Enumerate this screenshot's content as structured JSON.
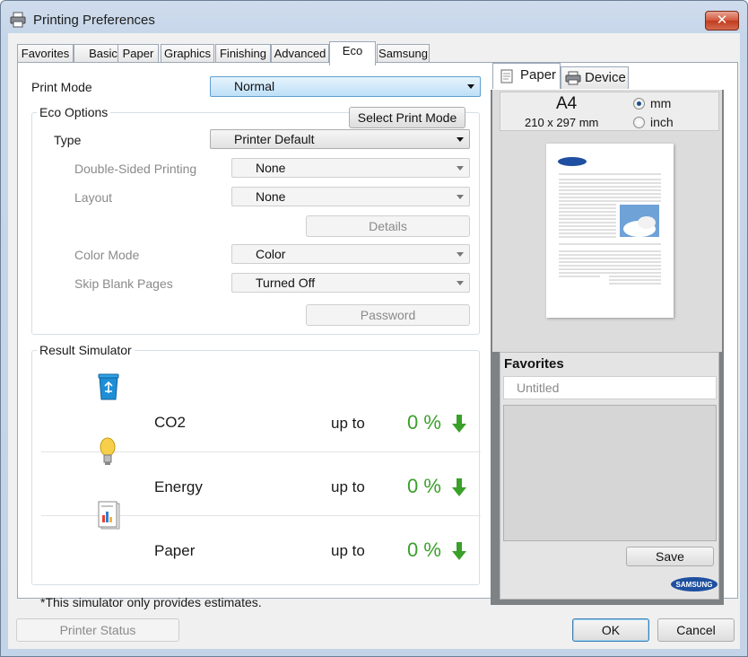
{
  "window": {
    "title": "Printing Preferences",
    "close_label": "✕"
  },
  "tabs": [
    {
      "label": "Favorites"
    },
    {
      "label": "Basic"
    },
    {
      "label": "Paper"
    },
    {
      "label": "Graphics"
    },
    {
      "label": "Finishing"
    },
    {
      "label": "Advanced"
    },
    {
      "label": "Eco"
    },
    {
      "label": "Samsung"
    }
  ],
  "active_tab": "Eco",
  "print_mode": {
    "label": "Print Mode",
    "value": "Normal"
  },
  "eco_options": {
    "title": "Eco Options",
    "select_print_mode_label": "Select Print Mode",
    "type_label": "Type",
    "type_value": "Printer Default",
    "double_sided_label": "Double-Sided Printing",
    "double_sided_value": "None",
    "layout_label": "Layout",
    "layout_value": "None",
    "details_label": "Details",
    "color_mode_label": "Color Mode",
    "color_mode_value": "Color",
    "skip_blank_label": "Skip Blank Pages",
    "skip_blank_value": "Turned Off",
    "password_label": "Password"
  },
  "result_simulator": {
    "title": "Result Simulator",
    "rows": [
      {
        "name": "CO2",
        "upto": "up to",
        "value": "0 %",
        "icon": "recycle-bin-icon"
      },
      {
        "name": "Energy",
        "upto": "up to",
        "value": "0 %",
        "icon": "light-bulb-icon"
      },
      {
        "name": "Paper",
        "upto": "up to",
        "value": "0 %",
        "icon": "paper-document-icon"
      }
    ],
    "footnote": "*This simulator only provides estimates."
  },
  "preview": {
    "tabs": [
      {
        "label": "Paper",
        "icon": "page-icon"
      },
      {
        "label": "Device",
        "icon": "printer-icon"
      }
    ],
    "paper_size": "A4",
    "paper_dims": "210 x 297 mm",
    "units": [
      {
        "label": "mm",
        "checked": true
      },
      {
        "label": "inch",
        "checked": false
      }
    ]
  },
  "favorites": {
    "title": "Favorites",
    "placeholder": "Untitled",
    "save_label": "Save"
  },
  "brand": {
    "logo_text": "SAMSUNG",
    "color": "#1f4fa0"
  },
  "footer": {
    "printer_status_label": "Printer Status",
    "ok_label": "OK",
    "cancel_label": "Cancel"
  },
  "colors": {
    "accent_green": "#3aa02a",
    "title_bar": "#c6d6ea",
    "close_red": "#c13b1f"
  }
}
